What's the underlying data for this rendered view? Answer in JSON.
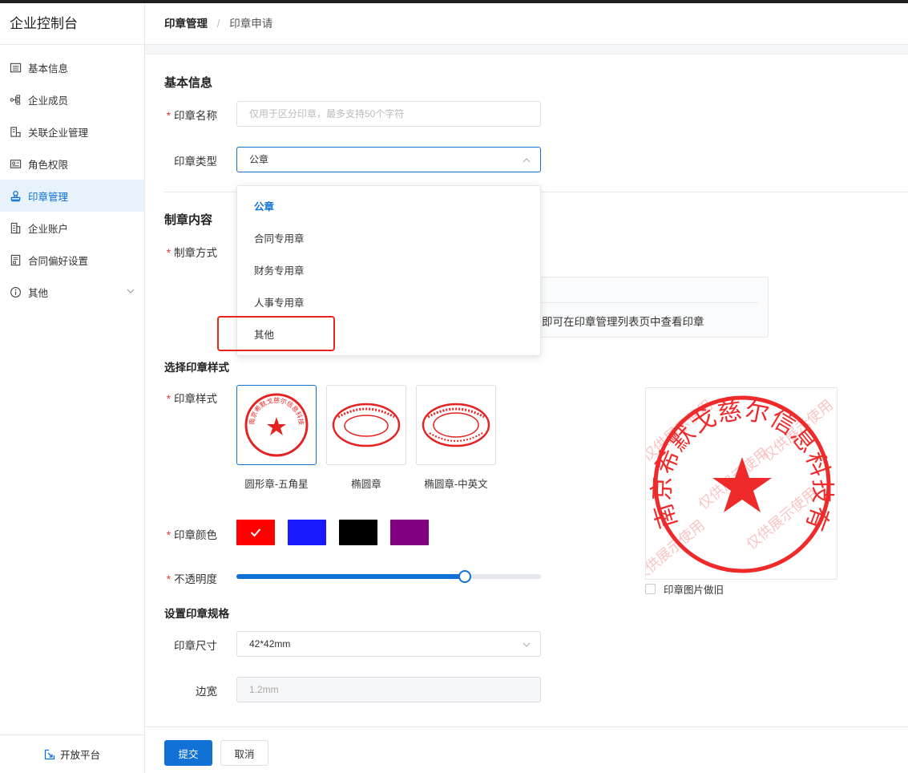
{
  "app": {
    "title": "企业控制台"
  },
  "sidebar": {
    "items": [
      {
        "label": "基本信息",
        "icon": "list-icon"
      },
      {
        "label": "企业成员",
        "icon": "org-tree-icon"
      },
      {
        "label": "关联企业管理",
        "icon": "building-link-icon"
      },
      {
        "label": "角色权限",
        "icon": "role-card-icon"
      },
      {
        "label": "印章管理",
        "icon": "stamp-icon",
        "active": true
      },
      {
        "label": "企业账户",
        "icon": "building-icon"
      },
      {
        "label": "合同偏好设置",
        "icon": "document-settings-icon"
      },
      {
        "label": "其他",
        "icon": "info-circle-icon",
        "expandable": true
      }
    ],
    "footer_label": "开放平台"
  },
  "breadcrumb": {
    "parent": "印章管理",
    "separator": "/",
    "current": "印章申请"
  },
  "basic": {
    "title": "基本信息",
    "name_label": "印章名称",
    "name_placeholder": "仅用于区分印章，最多支持50个字符",
    "type_label": "印章类型",
    "type_value": "公章"
  },
  "type_dropdown": {
    "options": [
      {
        "label": "公章",
        "selected": true
      },
      {
        "label": "合同专用章"
      },
      {
        "label": "财务专用章"
      },
      {
        "label": "人事专用章"
      },
      {
        "label": "其他",
        "highlighted": true
      }
    ]
  },
  "content": {
    "title": "制章内容",
    "method_label": "制章方式",
    "info_text": "即可在印章管理列表页中查看印章"
  },
  "style": {
    "title": "选择印章样式",
    "style_label": "印章样式",
    "options": [
      {
        "name": "圆形章-五角星",
        "selected": true
      },
      {
        "name": "椭圆章"
      },
      {
        "name": "椭圆章-中英文"
      }
    ],
    "color_label": "印章颜色",
    "colors": [
      {
        "hex": "#ff0000",
        "selected": true
      },
      {
        "hex": "#1a1aff"
      },
      {
        "hex": "#000000"
      },
      {
        "hex": "#800080"
      }
    ],
    "opacity_label": "不透明度",
    "opacity_value": 0.75,
    "preview": {
      "seal_text": "南京希默戈慈尔信息科技有限公司",
      "watermark": "仅供展示使用",
      "old_effect_label": "印章图片做旧",
      "accent": "#ee2a2a"
    }
  },
  "spec": {
    "title": "设置印章规格",
    "size_label": "印章尺寸",
    "size_value": "42*42mm",
    "border_label": "边宽",
    "border_value": "1.2mm"
  },
  "footer": {
    "submit_label": "提交",
    "cancel_label": "取消"
  },
  "colors": {
    "primary": "#1171d4",
    "required": "#e53935",
    "highlight_box": "#e6261f"
  }
}
